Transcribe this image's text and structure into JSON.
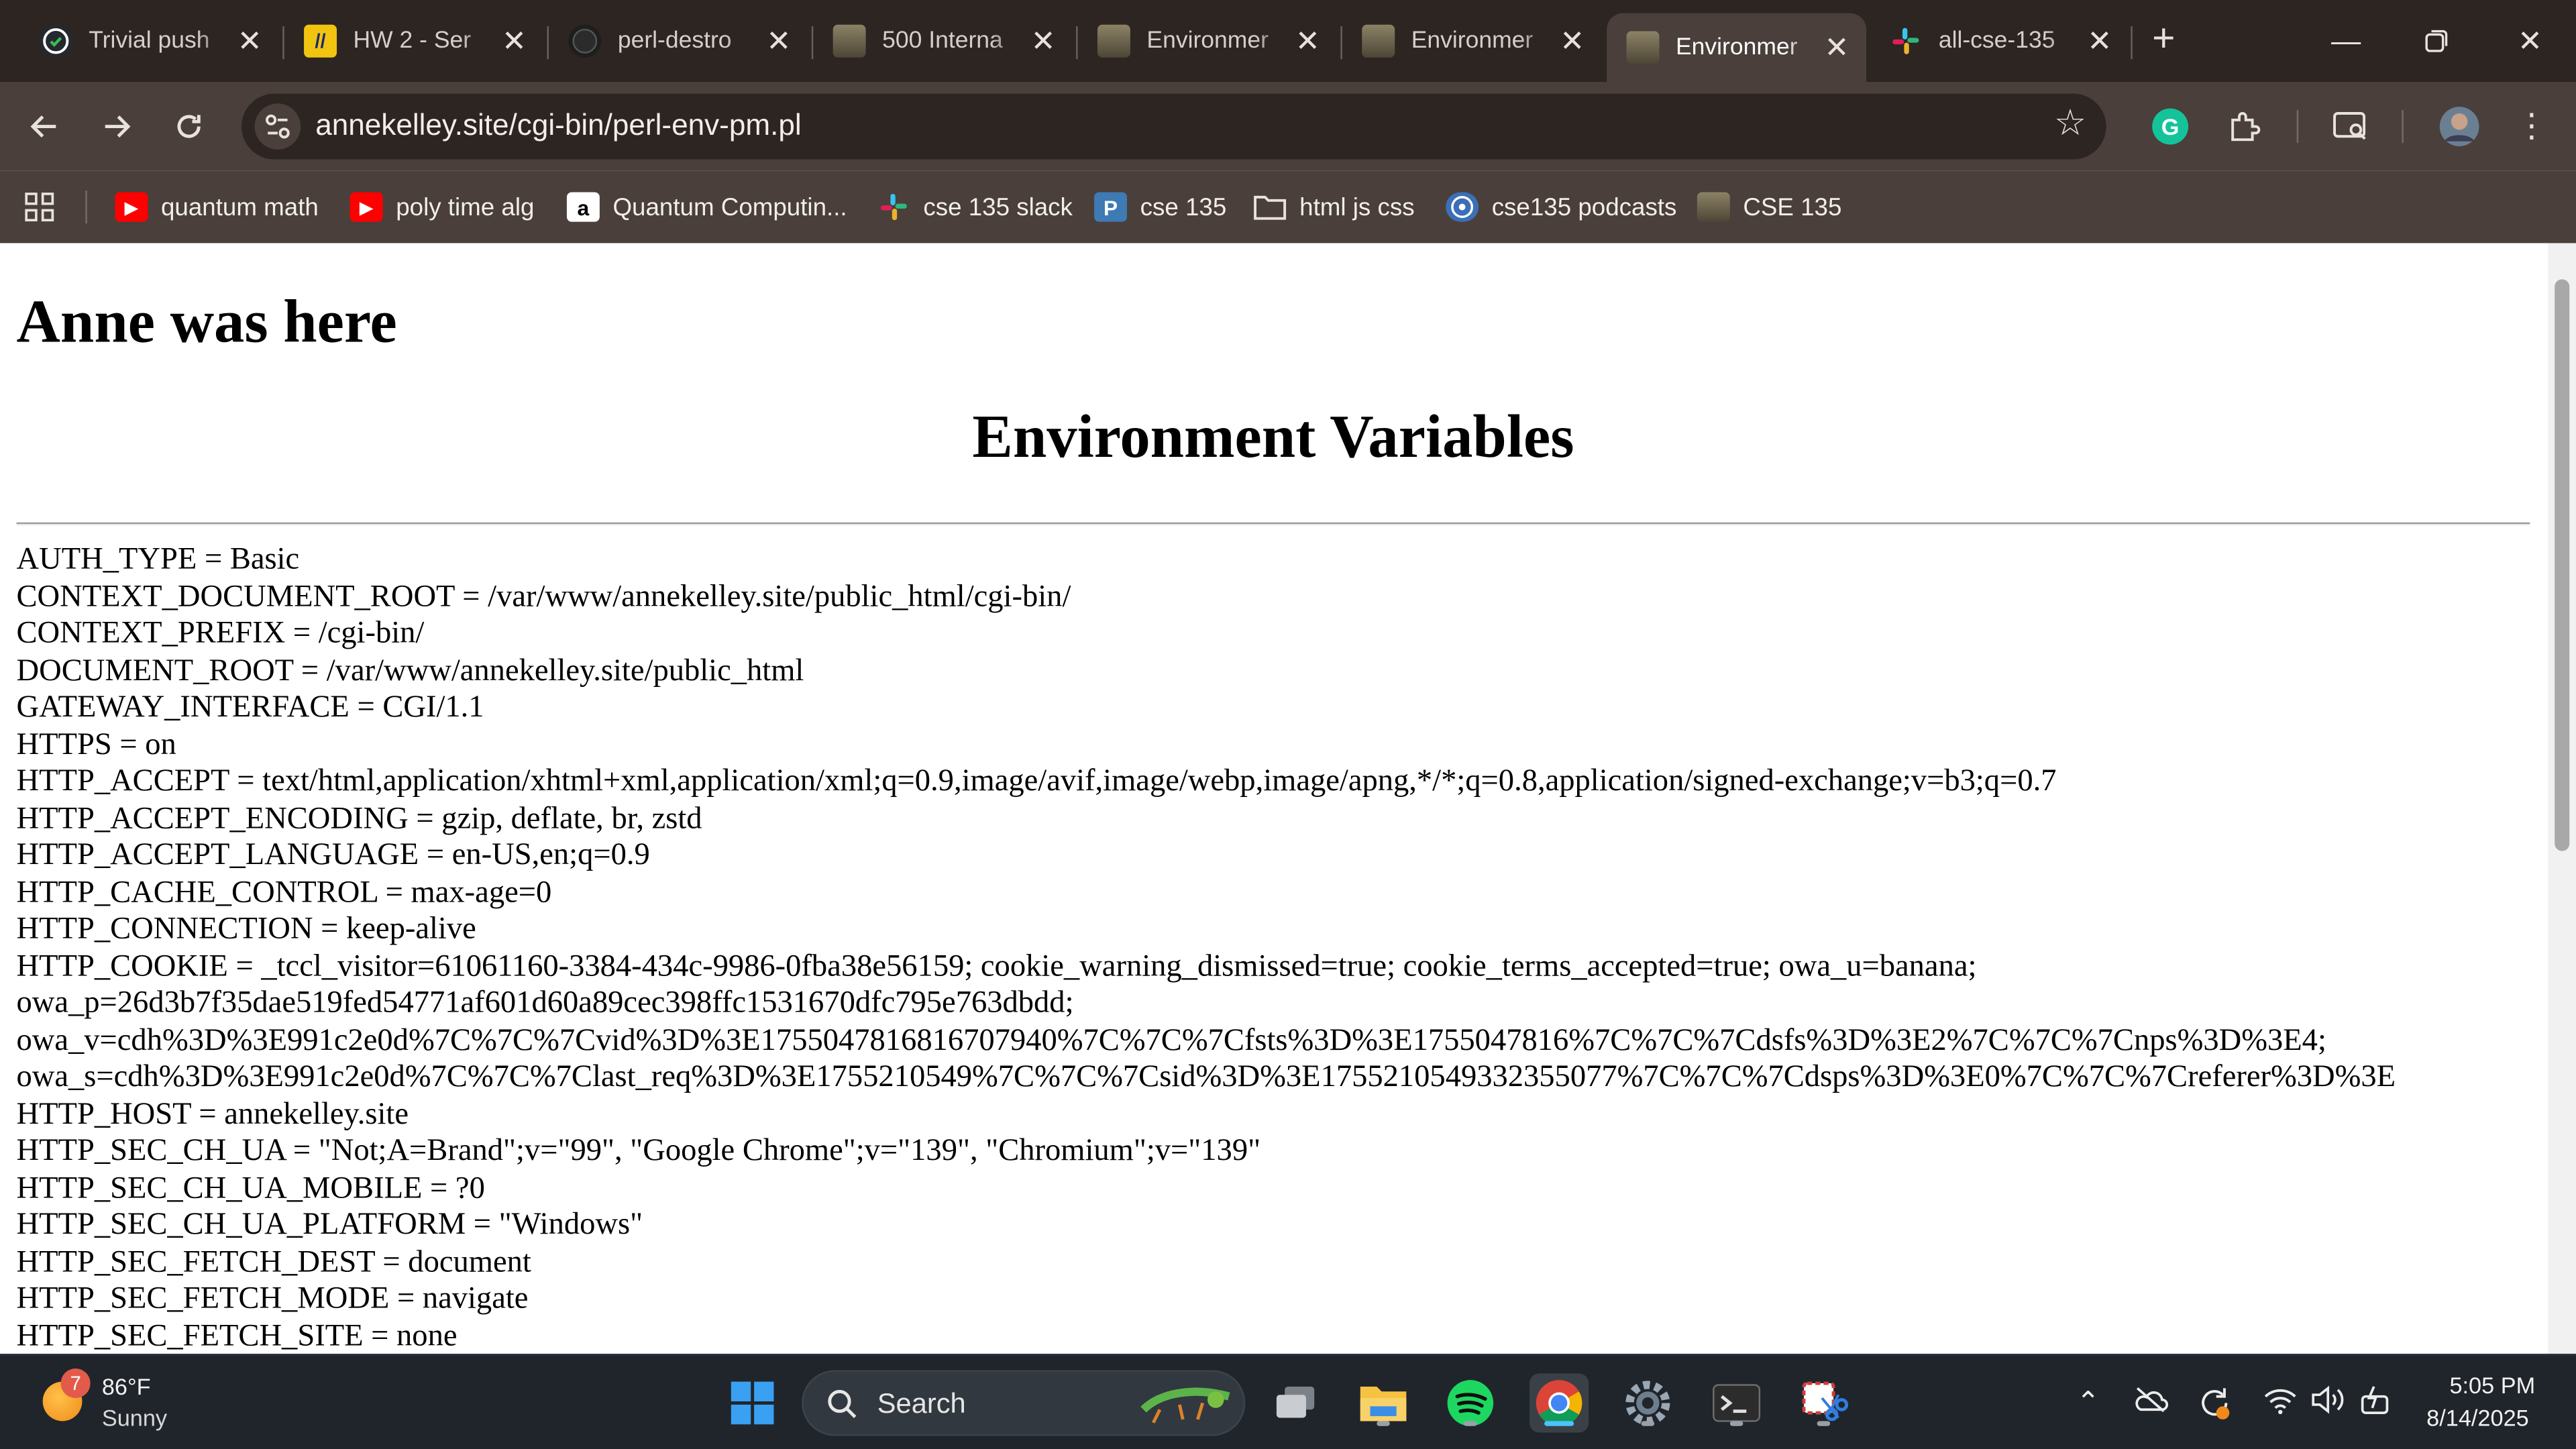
{
  "browser": {
    "tabs": [
      {
        "label": "Trivial push",
        "icon": "github-check-icon"
      },
      {
        "label": "HW 2 - Ser",
        "icon": "canvas-icon"
      },
      {
        "label": "perl-destro",
        "icon": "github-icon"
      },
      {
        "label": "500 Interna",
        "icon": "site-image-icon"
      },
      {
        "label": "Environmer",
        "icon": "site-image-icon"
      },
      {
        "label": "Environmer",
        "icon": "site-image-icon"
      },
      {
        "label": "Environmer",
        "icon": "site-image-icon",
        "active": true
      },
      {
        "label": "all-cse-135",
        "icon": "slack-icon"
      }
    ],
    "address": "annekelley.site/cgi-bin/perl-env-pm.pl",
    "bookmarks": [
      {
        "label": "quantum math",
        "icon": "youtube-icon"
      },
      {
        "label": "poly time alg",
        "icon": "youtube-icon"
      },
      {
        "label": "Quantum Computin...",
        "icon": "amazon-icon"
      },
      {
        "label": "cse 135 slack",
        "icon": "slack-icon"
      },
      {
        "label": "cse 135",
        "icon": "piazza-icon"
      },
      {
        "label": "html js css",
        "icon": "folder-icon"
      },
      {
        "label": "cse135 podcasts",
        "icon": "podcast-icon"
      },
      {
        "label": "CSE 135",
        "icon": "site-image-icon"
      }
    ]
  },
  "page": {
    "heading": "Anne was here",
    "subheading": "Environment Variables",
    "env_lines": [
      "AUTH_TYPE = Basic",
      "CONTEXT_DOCUMENT_ROOT = /var/www/annekelley.site/public_html/cgi-bin/",
      "CONTEXT_PREFIX = /cgi-bin/",
      "DOCUMENT_ROOT = /var/www/annekelley.site/public_html",
      "GATEWAY_INTERFACE = CGI/1.1",
      "HTTPS = on",
      "HTTP_ACCEPT = text/html,application/xhtml+xml,application/xml;q=0.9,image/avif,image/webp,image/apng,*/*;q=0.8,application/signed-exchange;v=b3;q=0.7",
      "HTTP_ACCEPT_ENCODING = gzip, deflate, br, zstd",
      "HTTP_ACCEPT_LANGUAGE = en-US,en;q=0.9",
      "HTTP_CACHE_CONTROL = max-age=0",
      "HTTP_CONNECTION = keep-alive",
      "HTTP_COOKIE = _tccl_visitor=61061160-3384-434c-9986-0fba38e56159; cookie_warning_dismissed=true; cookie_terms_accepted=true; owa_u=banana;",
      "owa_p=26d3b7f35dae519fed54771af601d60a89cec398ffc1531670dfc795e763dbdd;",
      "owa_v=cdh%3D%3E991c2e0d%7C%7C%7Cvid%3D%3E1755047816816707940%7C%7C%7Cfsts%3D%3E1755047816%7C%7C%7Cdsfs%3D%3E2%7C%7C%7Cnps%3D%3E4;",
      "owa_s=cdh%3D%3E991c2e0d%7C%7C%7Clast_req%3D%3E1755210549%7C%7C%7Csid%3D%3E1755210549332355077%7C%7C%7Cdsps%3D%3E0%7C%7C%7Creferer%3D%3E",
      "HTTP_HOST = annekelley.site",
      "HTTP_SEC_CH_UA = \"Not;A=Brand\";v=\"99\", \"Google Chrome\";v=\"139\", \"Chromium\";v=\"139\"",
      "HTTP_SEC_CH_UA_MOBILE = ?0",
      "HTTP_SEC_CH_UA_PLATFORM = \"Windows\"",
      "HTTP_SEC_FETCH_DEST = document",
      "HTTP_SEC_FETCH_MODE = navigate",
      "HTTP_SEC_FETCH_SITE = none"
    ]
  },
  "taskbar": {
    "weather_badge": "7",
    "weather_temp": "86°F",
    "weather_condition": "Sunny",
    "search_placeholder": "Search",
    "time": "5:05 PM",
    "date": "8/14/2025"
  },
  "colors": {
    "tabstrip_bg": "#2c2522",
    "toolbar_bg": "#4a3f3a",
    "taskbar_bg": "#20252b",
    "accent": "#4cc2ff"
  }
}
